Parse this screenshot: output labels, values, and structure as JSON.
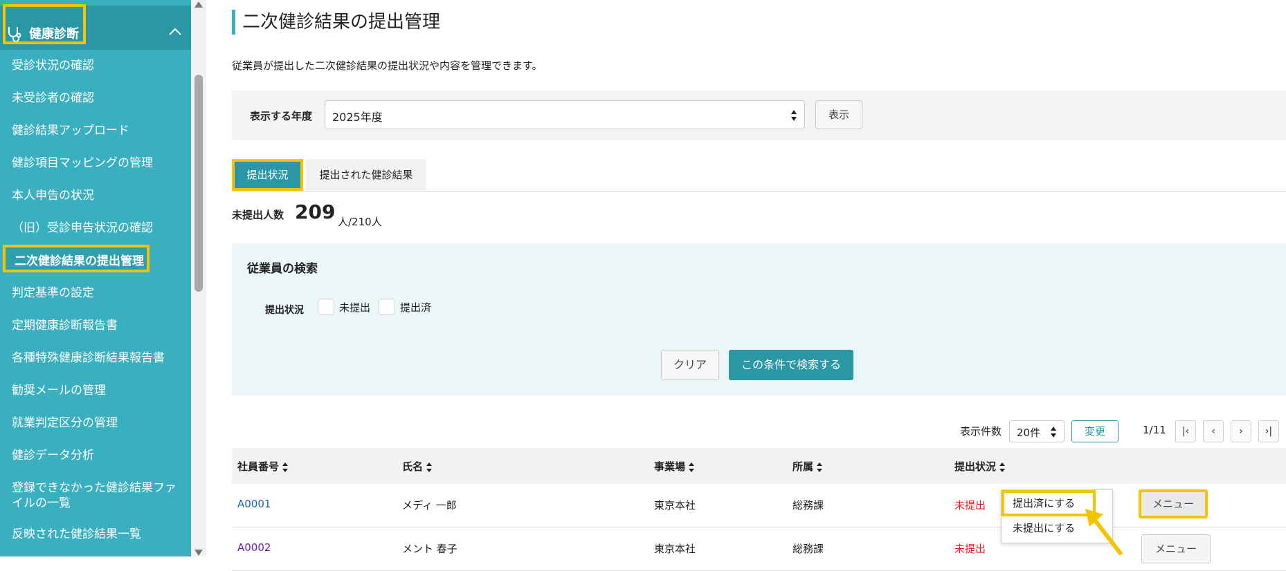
{
  "sidebar": {
    "header_label": "健康診断",
    "items": [
      {
        "label": "受診状況の確認"
      },
      {
        "label": "未受診者の確認"
      },
      {
        "label": "健診結果アップロード"
      },
      {
        "label": "健診項目マッピングの管理"
      },
      {
        "label": "本人申告の状況"
      },
      {
        "label": "（旧）受診申告状況の確認"
      },
      {
        "label": "二次健診結果の提出管理"
      },
      {
        "label": "判定基準の設定"
      },
      {
        "label": "定期健康診断報告書"
      },
      {
        "label": "各種特殊健康診断結果報告書"
      },
      {
        "label": "勧奨メールの管理"
      },
      {
        "label": "就業判定区分の管理"
      },
      {
        "label": "健診データ分析"
      },
      {
        "label": "登録できなかった健診結果ファイルの一覧"
      },
      {
        "label": "反映された健診結果一覧"
      }
    ]
  },
  "page": {
    "title": "二次健診結果の提出管理",
    "description": "従業員が提出した二次健診結果の提出状況や内容を管理できます。"
  },
  "year_filter": {
    "label": "表示する年度",
    "selected": "2025年度",
    "button": "表示"
  },
  "tabs": [
    {
      "label": "提出状況"
    },
    {
      "label": "提出された健診結果"
    }
  ],
  "summary": {
    "label": "未提出人数",
    "count": "209",
    "total": "人/210人"
  },
  "search": {
    "title": "従業員の検索",
    "status_label": "提出状況",
    "options": [
      "未提出",
      "提出済"
    ],
    "clear_button": "クリア",
    "search_button": "この条件で検索する"
  },
  "pagination": {
    "per_page_label": "表示件数",
    "per_page_value": "20件",
    "change_button": "変更",
    "page_info": "1/11"
  },
  "table": {
    "headers": [
      "社員番号",
      "氏名",
      "事業場",
      "所属",
      "提出状況"
    ],
    "rows": [
      {
        "id": "A0001",
        "name": "メディ 一郎",
        "site": "東京本社",
        "dept": "総務課",
        "status": "未提出",
        "menu": "メニュー"
      },
      {
        "id": "A0002",
        "name": "メント 春子",
        "site": "東京本社",
        "dept": "総務課",
        "status": "未提出",
        "menu": "メニュー"
      }
    ]
  },
  "dropdown": {
    "items": [
      "提出済にする",
      "未提出にする"
    ]
  },
  "colors": {
    "sidebar": "#3aafbf",
    "accent": "#2a97a6",
    "highlight": "#f5c400",
    "status_red": "#e02020",
    "link": "#1a62c0"
  }
}
